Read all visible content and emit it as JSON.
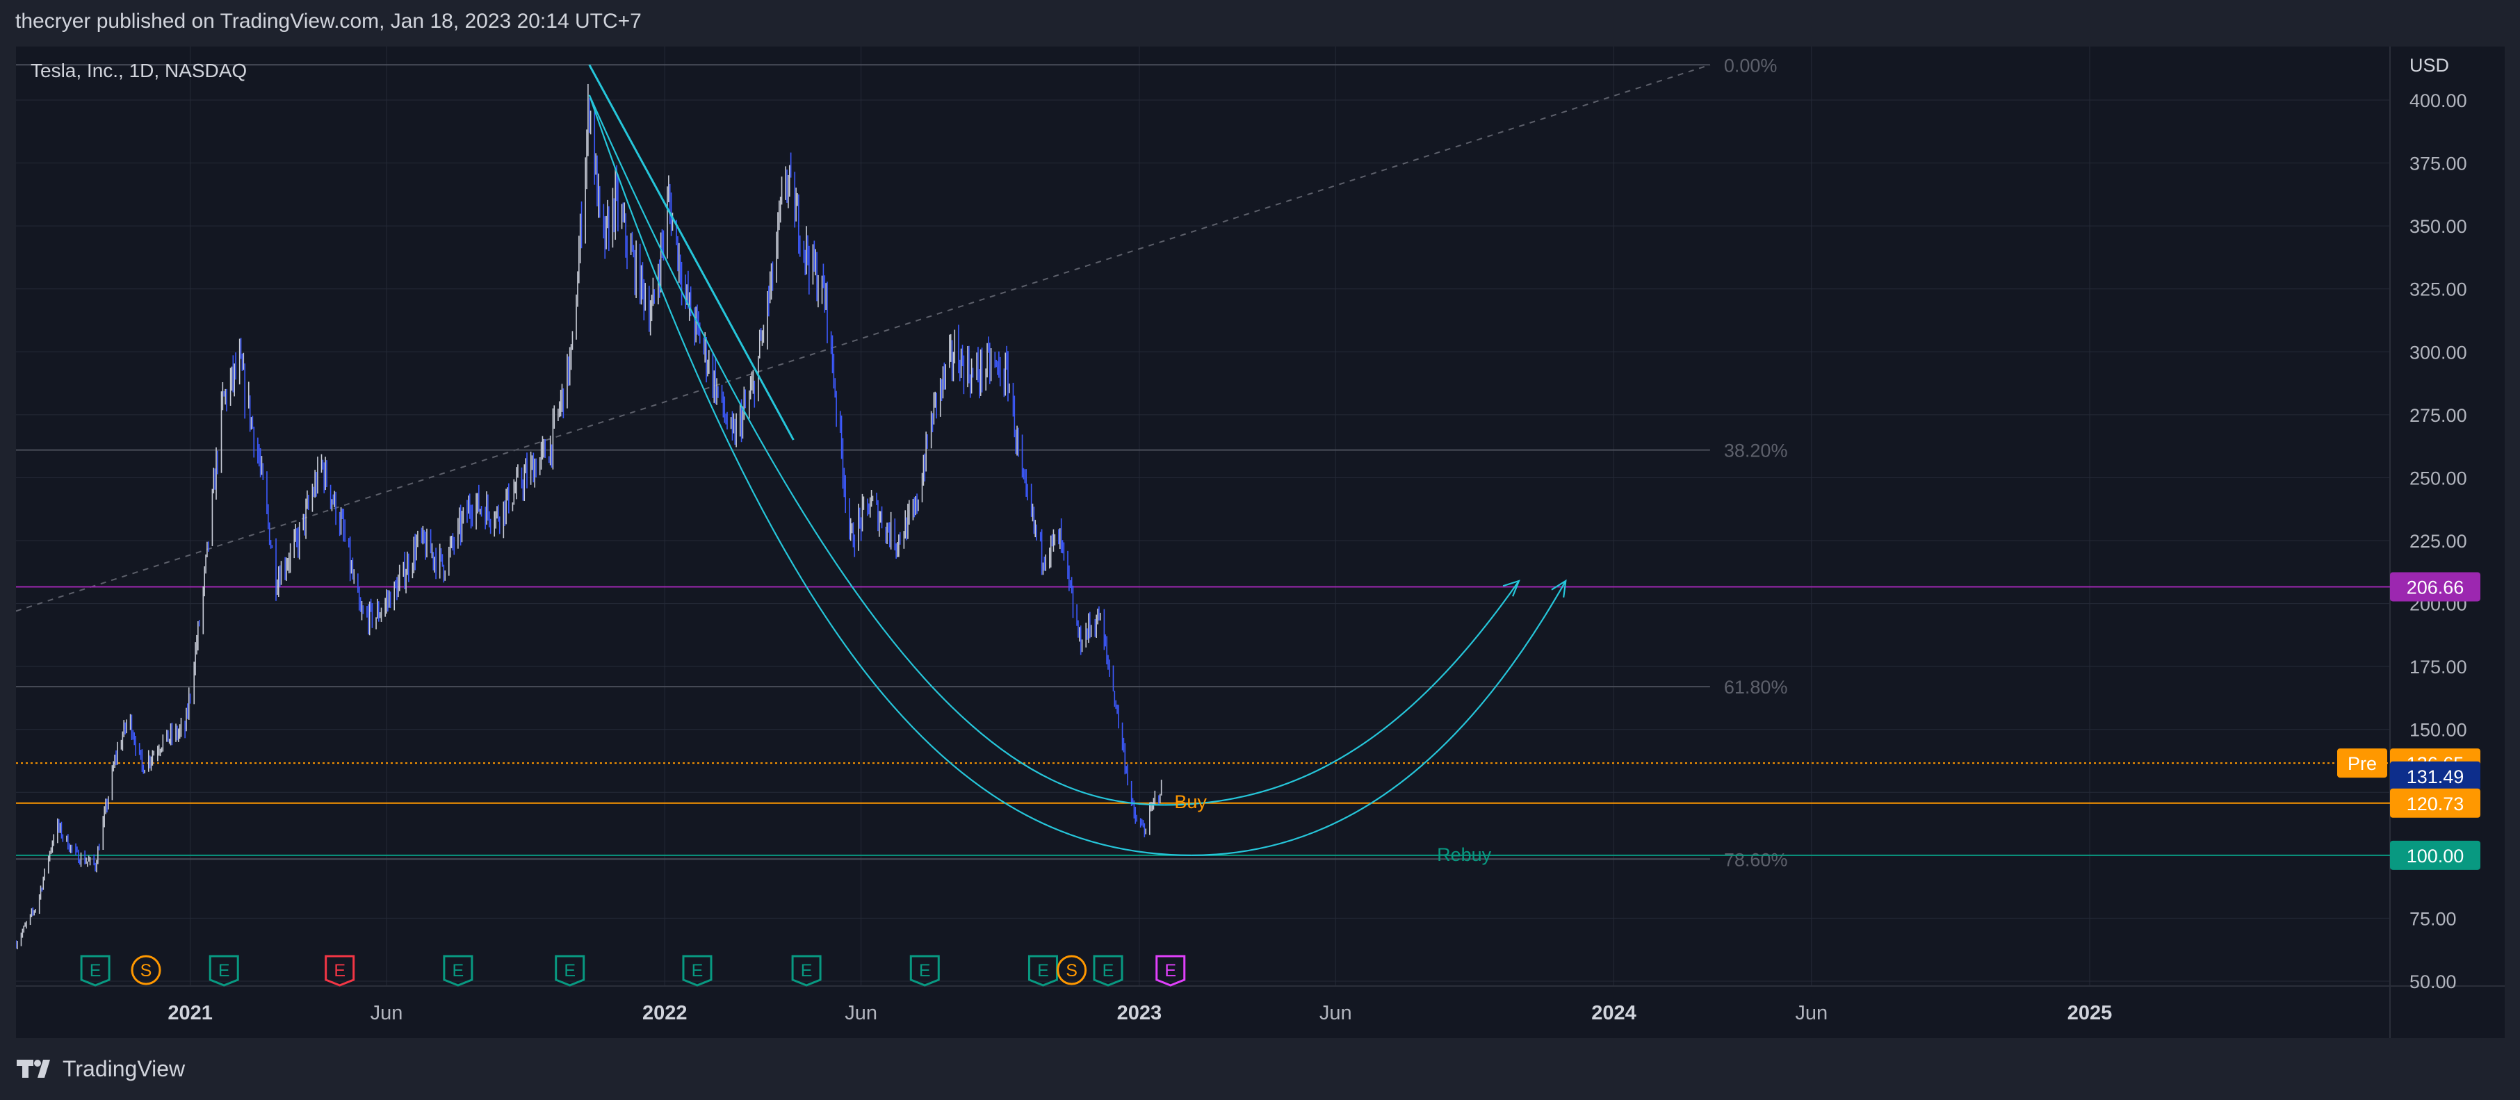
{
  "header": {
    "publisher": "thecryer published on TradingView.com, Jan 18, 2023 20:14 UTC+7"
  },
  "symbol": {
    "title": "Tesla, Inc., 1D, NASDAQ"
  },
  "footer": {
    "brand": "TradingView",
    "logo_icon": "tradingview-logo-icon"
  },
  "colors": {
    "background": "#1e222d",
    "pane": "#131722",
    "grid": "#252a37",
    "candle": "#3d5afe",
    "candle_alt": "#c7cbd6",
    "arc": "#26c6da",
    "purple_line": "#9c27b0",
    "orange_line": "#ff9800",
    "green_line": "#089981",
    "fib_text": "#5d606b",
    "blue_tag": "#0d2e8c"
  },
  "chart_data": {
    "type": "candlestick",
    "price_axis": {
      "currency": "USD",
      "ticks": [
        "50.00",
        "75.00",
        "100.00",
        "125.00",
        "150.00",
        "175.00",
        "200.00",
        "225.00",
        "250.00",
        "275.00",
        "300.00",
        "325.00",
        "350.00",
        "375.00",
        "400.00"
      ],
      "range": [
        45,
        414
      ]
    },
    "time_axis": {
      "ticks": [
        {
          "label": "2021",
          "date": "2021-01-01",
          "bold": true
        },
        {
          "label": "Jun",
          "date": "2021-06-01",
          "bold": false
        },
        {
          "label": "2022",
          "date": "2022-01-01",
          "bold": true
        },
        {
          "label": "Jun",
          "date": "2022-06-01",
          "bold": false
        },
        {
          "label": "2023",
          "date": "2023-01-01",
          "bold": true
        },
        {
          "label": "Jun",
          "date": "2023-06-01",
          "bold": false
        },
        {
          "label": "2024",
          "date": "2024-01-01",
          "bold": true
        },
        {
          "label": "Jun",
          "date": "2024-06-01",
          "bold": false
        },
        {
          "label": "2025",
          "date": "2025-01-01",
          "bold": true
        }
      ],
      "range": [
        "2020-08-20",
        "2025-08-20"
      ]
    },
    "price_path": [
      [
        "2020-08-20",
        65
      ],
      [
        "2020-09-05",
        80
      ],
      [
        "2020-09-20",
        112
      ],
      [
        "2020-10-05",
        100
      ],
      [
        "2020-10-20",
        96
      ],
      [
        "2020-11-05",
        140
      ],
      [
        "2020-11-15",
        155
      ],
      [
        "2020-11-25",
        135
      ],
      [
        "2020-12-10",
        145
      ],
      [
        "2020-12-28",
        150
      ],
      [
        "2021-01-10",
        200
      ],
      [
        "2021-01-26",
        280
      ],
      [
        "2021-02-08",
        295
      ],
      [
        "2021-02-22",
        260
      ],
      [
        "2021-03-08",
        210
      ],
      [
        "2021-03-25",
        225
      ],
      [
        "2021-04-12",
        255
      ],
      [
        "2021-04-28",
        230
      ],
      [
        "2021-05-12",
        195
      ],
      [
        "2021-05-24",
        195
      ],
      [
        "2021-06-10",
        207
      ],
      [
        "2021-06-26",
        225
      ],
      [
        "2021-07-15",
        215
      ],
      [
        "2021-08-05",
        240
      ],
      [
        "2021-08-25",
        235
      ],
      [
        "2021-09-15",
        250
      ],
      [
        "2021-10-05",
        262
      ],
      [
        "2021-10-22",
        300
      ],
      [
        "2021-11-04",
        400
      ],
      [
        "2021-11-14",
        340
      ],
      [
        "2021-11-24",
        360
      ],
      [
        "2021-12-08",
        335
      ],
      [
        "2021-12-22",
        315
      ],
      [
        "2022-01-04",
        360
      ],
      [
        "2022-01-18",
        320
      ],
      [
        "2022-02-01",
        300
      ],
      [
        "2022-02-22",
        265
      ],
      [
        "2022-03-10",
        285
      ],
      [
        "2022-03-25",
        330
      ],
      [
        "2022-04-04",
        370
      ],
      [
        "2022-04-20",
        340
      ],
      [
        "2022-05-05",
        320
      ],
      [
        "2022-05-24",
        225
      ],
      [
        "2022-06-08",
        240
      ],
      [
        "2022-06-28",
        225
      ],
      [
        "2022-07-12",
        235
      ],
      [
        "2022-07-28",
        280
      ],
      [
        "2022-08-12",
        300
      ],
      [
        "2022-08-26",
        290
      ],
      [
        "2022-09-08",
        295
      ],
      [
        "2022-09-22",
        290
      ],
      [
        "2022-10-04",
        245
      ],
      [
        "2022-10-18",
        220
      ],
      [
        "2022-11-01",
        225
      ],
      [
        "2022-11-16",
        185
      ],
      [
        "2022-12-01",
        195
      ],
      [
        "2022-12-14",
        160
      ],
      [
        "2022-12-28",
        115
      ],
      [
        "2023-01-05",
        110
      ],
      [
        "2023-01-13",
        122
      ],
      [
        "2023-01-18",
        127
      ]
    ],
    "last": {
      "date": "2023-01-18",
      "close": 131.49,
      "pre": 136.65
    },
    "horizontal_lines": [
      {
        "price": 206.66,
        "label": "206.66",
        "color": "#9c27b0"
      },
      {
        "price": 136.65,
        "label": "136.65",
        "color": "#ff9800",
        "style": "dotted",
        "tag": "Pre"
      },
      {
        "price": 131.49,
        "label": "131.49",
        "color": "#0d2e8c",
        "tag_only": true
      },
      {
        "price": 120.73,
        "label": "120.73",
        "color": "#ff9800"
      },
      {
        "price": 100.0,
        "label": "100.00",
        "color": "#089981"
      }
    ],
    "fibonacci": {
      "start": [
        "2020-08-20",
        197
      ],
      "end": [
        "2024-03-15",
        414
      ],
      "levels": [
        {
          "label": "0.00%",
          "price": 414
        },
        {
          "label": "38.20%",
          "price": 261
        },
        {
          "label": "61.80%",
          "price": 167
        },
        {
          "label": "78.60%",
          "price": 98.5
        }
      ]
    },
    "annotations": [
      {
        "text": "Buy",
        "date": "2023-01-28",
        "price": 121,
        "color": "#ff9800"
      },
      {
        "text": "Rebuy",
        "date": "2023-08-18",
        "price": 100,
        "color": "#089981"
      }
    ],
    "events": [
      {
        "type": "E",
        "date": "2020-10-20",
        "color": "#089981"
      },
      {
        "type": "S",
        "date": "2020-11-28",
        "color": "#ff9800"
      },
      {
        "type": "E",
        "date": "2021-01-27",
        "color": "#089981"
      },
      {
        "type": "E",
        "date": "2021-04-26",
        "color": "#f23645"
      },
      {
        "type": "E",
        "date": "2021-07-26",
        "color": "#089981"
      },
      {
        "type": "E",
        "date": "2021-10-20",
        "color": "#089981"
      },
      {
        "type": "E",
        "date": "2022-01-26",
        "color": "#089981"
      },
      {
        "type": "E",
        "date": "2022-04-20",
        "color": "#089981"
      },
      {
        "type": "E",
        "date": "2022-07-20",
        "color": "#089981"
      },
      {
        "type": "E",
        "date": "2022-10-19",
        "color": "#089981"
      },
      {
        "type": "S",
        "date": "2022-11-10",
        "color": "#ff9800"
      },
      {
        "type": "E",
        "date": "2022-12-08",
        "color": "#089981"
      },
      {
        "type": "E",
        "date": "2023-01-25",
        "color": "#e040fb"
      }
    ]
  }
}
